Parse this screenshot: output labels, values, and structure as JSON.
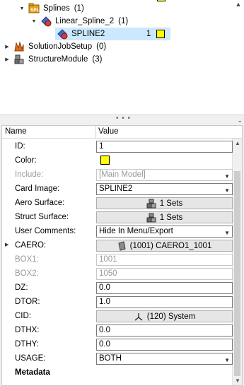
{
  "tree": {
    "items": [
      {
        "label": "Splines",
        "count": "(1)",
        "icon": "splines-folder-icon"
      },
      {
        "label": "Linear_Spline_2",
        "count": "(1)",
        "icon": "spline-group-icon"
      },
      {
        "label": "SPLINE2",
        "count": "1",
        "icon": "spline-entity-icon",
        "color": "#ffff00"
      },
      {
        "label": "SolutionJobSetup",
        "count": "(0)",
        "icon": "solution-job-icon"
      },
      {
        "label": "StructureModule",
        "count": "(3)",
        "icon": "structure-module-icon"
      }
    ]
  },
  "splitter": {
    "grip": "• • •"
  },
  "properties": {
    "header": {
      "name": "Name",
      "value": "Value"
    },
    "rows": {
      "id": {
        "label": "ID:",
        "value": "1"
      },
      "color": {
        "label": "Color:",
        "value": "#ffff00"
      },
      "include": {
        "label": "Include:",
        "value": "[Main Model]"
      },
      "card_image": {
        "label": "Card Image:",
        "value": "SPLINE2"
      },
      "aero_surface": {
        "label": "Aero Surface:",
        "value": "1 Sets"
      },
      "struct_surface": {
        "label": "Struct Surface:",
        "value": "1 Sets"
      },
      "user_comments": {
        "label": "User Comments:",
        "value": "Hide In Menu/Export"
      },
      "caero": {
        "label": "CAERO:",
        "value": "(1001) CAERO1_1001"
      },
      "box1": {
        "label": "BOX1:",
        "value": "1001"
      },
      "box2": {
        "label": "BOX2:",
        "value": "1050"
      },
      "dz": {
        "label": "DZ:",
        "value": "0.0"
      },
      "dtor": {
        "label": "DTOR:",
        "value": "1.0"
      },
      "cid": {
        "label": "CID:",
        "value": "(120) System"
      },
      "dthx": {
        "label": "DTHX:",
        "value": "0.0"
      },
      "dthy": {
        "label": "DTHY:",
        "value": "0.0"
      },
      "usage": {
        "label": "USAGE:",
        "value": "BOTH"
      },
      "metadata": {
        "label": "Metadata"
      }
    }
  },
  "colors": {
    "accent_selection": "#cce8ff",
    "spline_color": "#ffff00"
  }
}
